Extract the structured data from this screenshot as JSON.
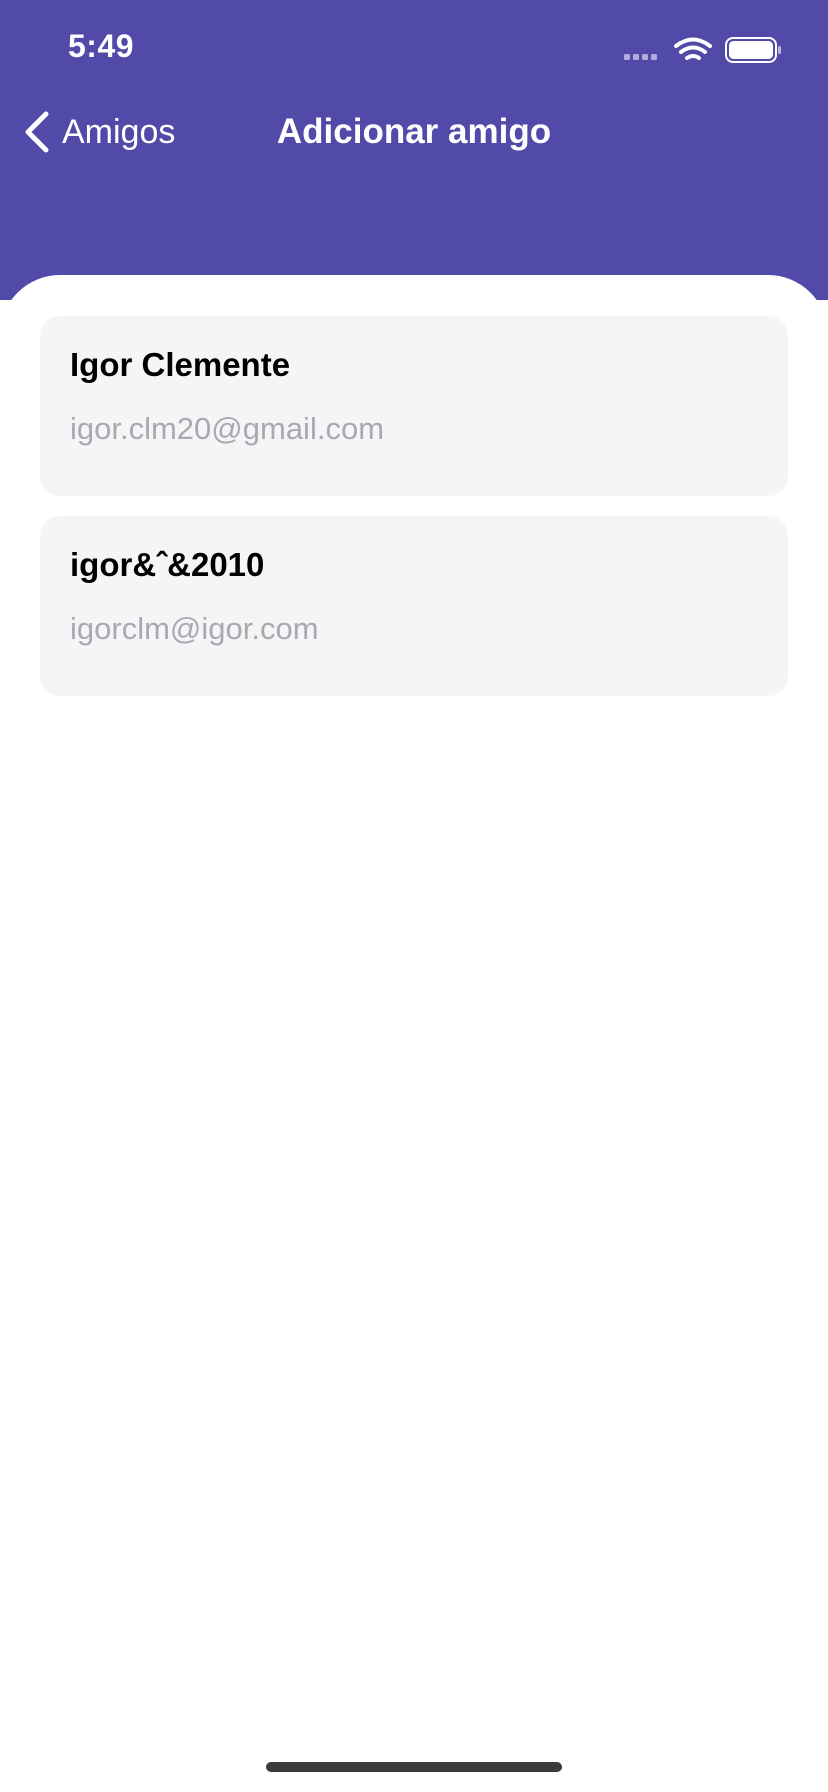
{
  "status_bar": {
    "time": "5:49",
    "icons": [
      "cellular-signal-icon",
      "wifi-icon",
      "battery-icon"
    ]
  },
  "nav": {
    "back_label": "Amigos",
    "title": "Adicionar amigo"
  },
  "friends": [
    {
      "name": "Igor Clemente",
      "email": "igor.clm20@gmail.com"
    },
    {
      "name": "igor&ˆ&2010",
      "email": "igorclm@igor.com"
    }
  ],
  "colors": {
    "header_bg": "#524AA8",
    "card_bg": "#F5F5F7",
    "email_text": "#A9A9AE"
  }
}
